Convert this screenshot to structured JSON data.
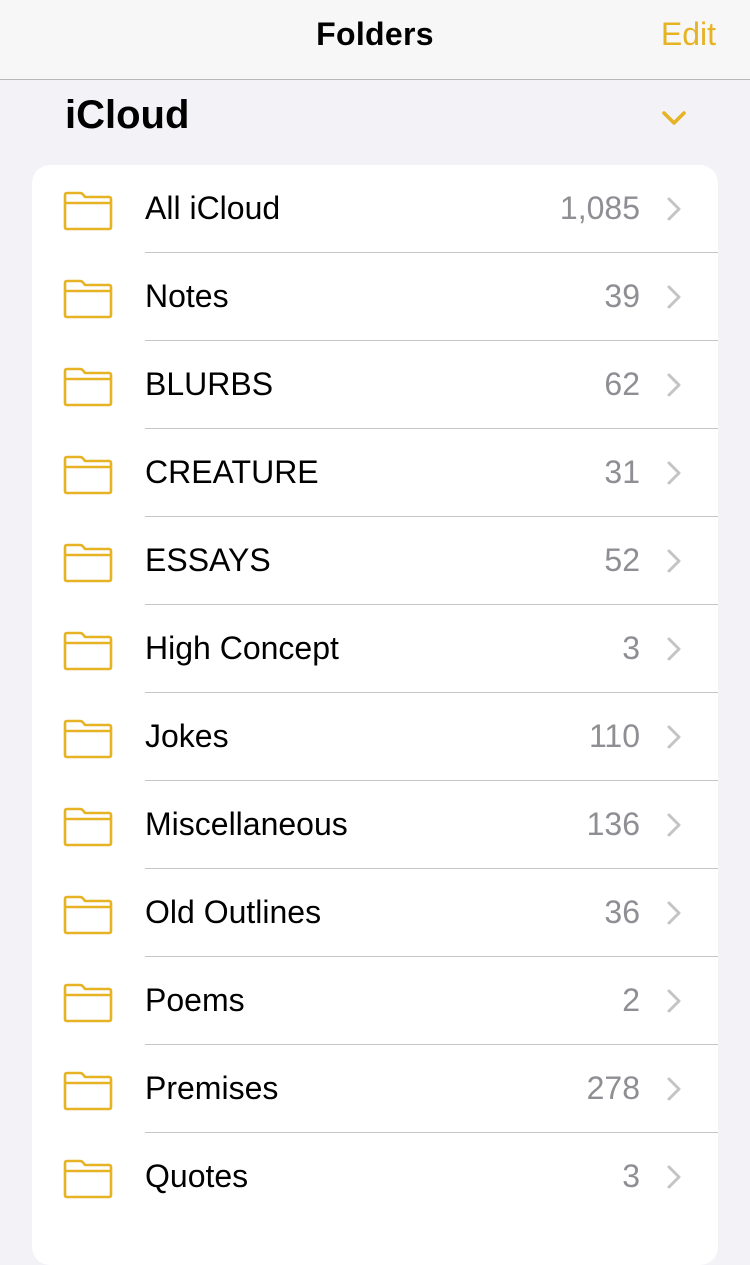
{
  "nav": {
    "title": "Folders",
    "edit_label": "Edit"
  },
  "section": {
    "title": "iCloud"
  },
  "colors": {
    "accent": "#e6b325",
    "secondary_text": "#8e8e93",
    "background": "#f2f2f7"
  },
  "folders": [
    {
      "name": "All iCloud",
      "count": "1,085"
    },
    {
      "name": "Notes",
      "count": "39"
    },
    {
      "name": "BLURBS",
      "count": "62"
    },
    {
      "name": "CREATURE",
      "count": "31"
    },
    {
      "name": "ESSAYS",
      "count": "52"
    },
    {
      "name": "High Concept",
      "count": "3"
    },
    {
      "name": "Jokes",
      "count": "110"
    },
    {
      "name": "Miscellaneous",
      "count": "136"
    },
    {
      "name": "Old Outlines",
      "count": "36"
    },
    {
      "name": "Poems",
      "count": "2"
    },
    {
      "name": "Premises",
      "count": "278"
    },
    {
      "name": "Quotes",
      "count": "3"
    }
  ]
}
